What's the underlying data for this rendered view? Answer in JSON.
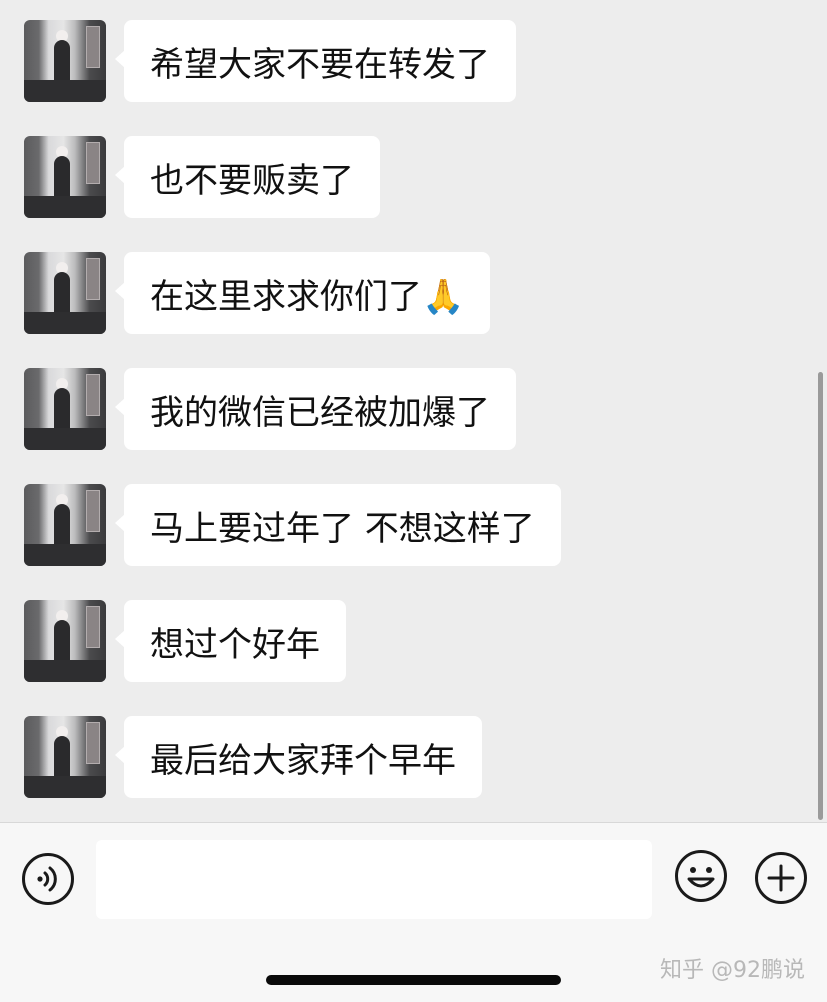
{
  "messages": [
    {
      "text": "希望大家不要在转发了"
    },
    {
      "text": "也不要贩卖了"
    },
    {
      "text": "在这里求求你们了🙏"
    },
    {
      "text": "我的微信已经被加爆了"
    },
    {
      "text": "马上要过年了 不想这样了"
    },
    {
      "text": "想过个好年"
    },
    {
      "text": "最后给大家拜个早年"
    }
  ],
  "input": {
    "value": "",
    "placeholder": ""
  },
  "icons": {
    "voice": "voice-icon",
    "emoji": "emoji-icon",
    "plus": "plus-icon"
  },
  "watermark": "知乎 @92鹏说",
  "colors": {
    "background": "#ededed",
    "bubble": "#ffffff",
    "input_bar": "#f7f7f7"
  }
}
